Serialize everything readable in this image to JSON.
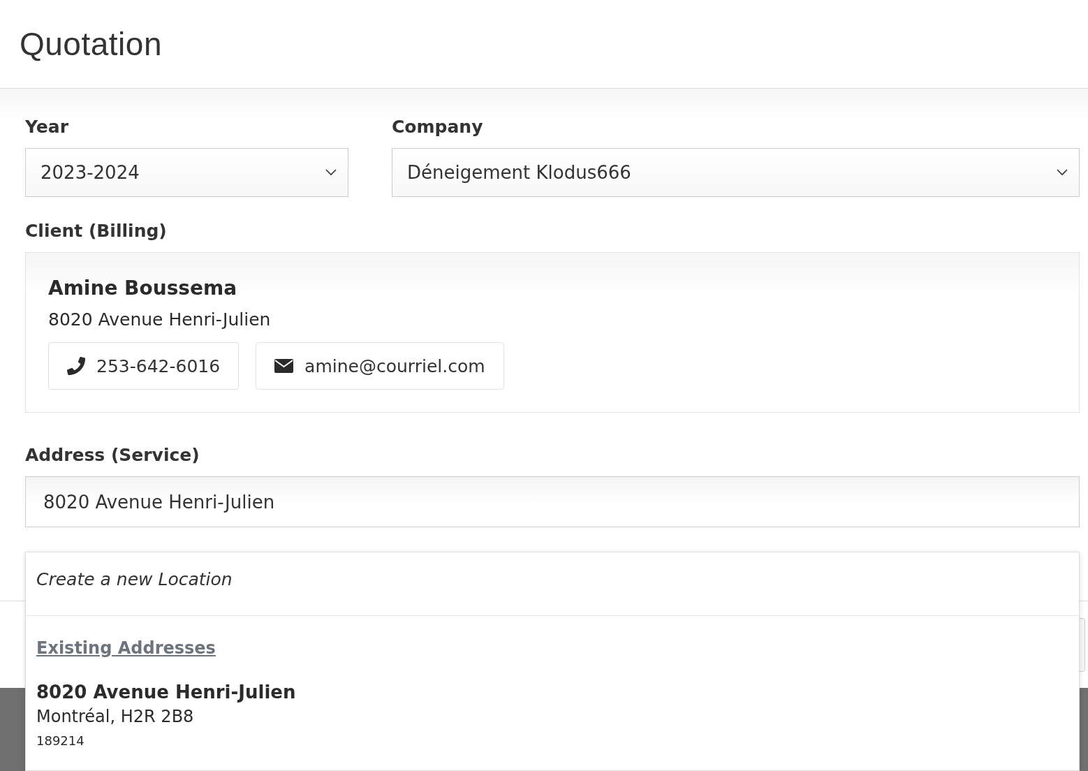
{
  "title": "Quotation",
  "year": {
    "label": "Year",
    "value": "2023-2024"
  },
  "company": {
    "label": "Company",
    "value": "Déneigement Klodus666"
  },
  "client": {
    "label": "Client (Billing)",
    "name": "Amine Boussema",
    "address": "8020 Avenue Henri-Julien",
    "phone": "253-642-6016",
    "email": "amine@courriel.com"
  },
  "service_address": {
    "label": "Address (Service)",
    "value": "8020 Avenue Henri-Julien"
  },
  "dropdown": {
    "create_option": "Create a new Location",
    "group_heading": "Existing Addresses",
    "options": [
      {
        "street": "8020 Avenue Henri-Julien",
        "city": "Montréal, H2R 2B8",
        "code": "189214"
      }
    ]
  }
}
